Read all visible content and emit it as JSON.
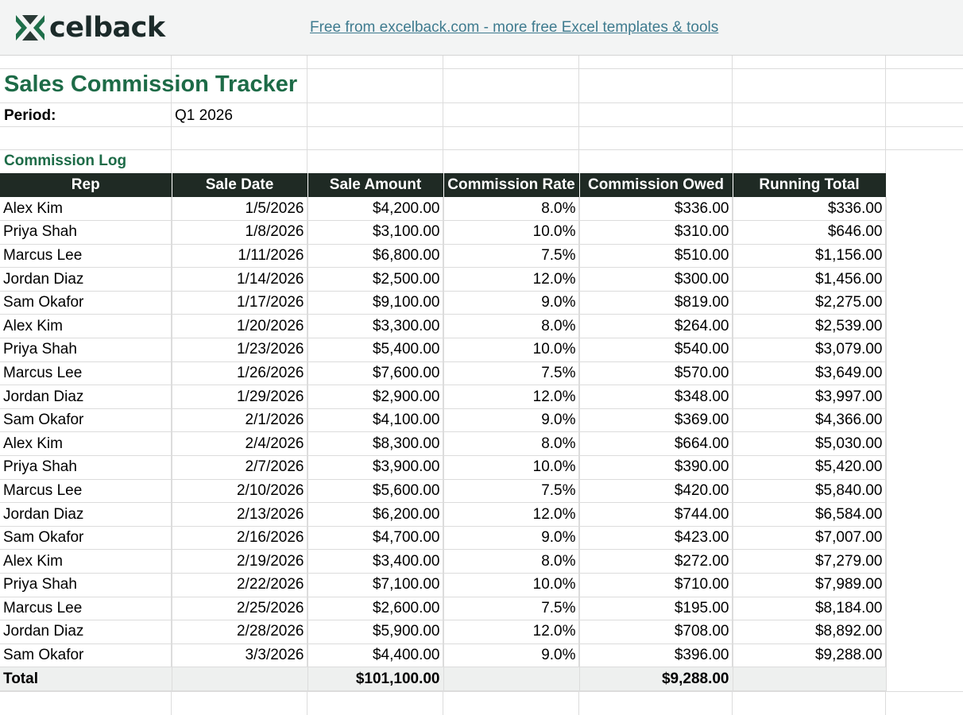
{
  "banner": {
    "logo_text": "celback",
    "link_text": "Free from excelback.com - more free Excel templates & tools"
  },
  "sheet": {
    "title": "Sales Commission Tracker",
    "period_label": "Period:",
    "period_value": "Q1 2026",
    "section_label": "Commission Log",
    "headers": [
      "Rep",
      "Sale Date",
      "Sale Amount",
      "Commission Rate",
      "Commission Owed",
      "Running Total"
    ],
    "rows": [
      [
        "Alex Kim",
        "1/5/2026",
        "$4,200.00",
        "8.0%",
        "$336.00",
        "$336.00"
      ],
      [
        "Priya Shah",
        "1/8/2026",
        "$3,100.00",
        "10.0%",
        "$310.00",
        "$646.00"
      ],
      [
        "Marcus Lee",
        "1/11/2026",
        "$6,800.00",
        "7.5%",
        "$510.00",
        "$1,156.00"
      ],
      [
        "Jordan Diaz",
        "1/14/2026",
        "$2,500.00",
        "12.0%",
        "$300.00",
        "$1,456.00"
      ],
      [
        "Sam Okafor",
        "1/17/2026",
        "$9,100.00",
        "9.0%",
        "$819.00",
        "$2,275.00"
      ],
      [
        "Alex Kim",
        "1/20/2026",
        "$3,300.00",
        "8.0%",
        "$264.00",
        "$2,539.00"
      ],
      [
        "Priya Shah",
        "1/23/2026",
        "$5,400.00",
        "10.0%",
        "$540.00",
        "$3,079.00"
      ],
      [
        "Marcus Lee",
        "1/26/2026",
        "$7,600.00",
        "7.5%",
        "$570.00",
        "$3,649.00"
      ],
      [
        "Jordan Diaz",
        "1/29/2026",
        "$2,900.00",
        "12.0%",
        "$348.00",
        "$3,997.00"
      ],
      [
        "Sam Okafor",
        "2/1/2026",
        "$4,100.00",
        "9.0%",
        "$369.00",
        "$4,366.00"
      ],
      [
        "Alex Kim",
        "2/4/2026",
        "$8,300.00",
        "8.0%",
        "$664.00",
        "$5,030.00"
      ],
      [
        "Priya Shah",
        "2/7/2026",
        "$3,900.00",
        "10.0%",
        "$390.00",
        "$5,420.00"
      ],
      [
        "Marcus Lee",
        "2/10/2026",
        "$5,600.00",
        "7.5%",
        "$420.00",
        "$5,840.00"
      ],
      [
        "Jordan Diaz",
        "2/13/2026",
        "$6,200.00",
        "12.0%",
        "$744.00",
        "$6,584.00"
      ],
      [
        "Sam Okafor",
        "2/16/2026",
        "$4,700.00",
        "9.0%",
        "$423.00",
        "$7,007.00"
      ],
      [
        "Alex Kim",
        "2/19/2026",
        "$3,400.00",
        "8.0%",
        "$272.00",
        "$7,279.00"
      ],
      [
        "Priya Shah",
        "2/22/2026",
        "$7,100.00",
        "10.0%",
        "$710.00",
        "$7,989.00"
      ],
      [
        "Marcus Lee",
        "2/25/2026",
        "$2,600.00",
        "7.5%",
        "$195.00",
        "$8,184.00"
      ],
      [
        "Jordan Diaz",
        "2/28/2026",
        "$5,900.00",
        "12.0%",
        "$708.00",
        "$8,892.00"
      ],
      [
        "Sam Okafor",
        "3/3/2026",
        "$4,400.00",
        "9.0%",
        "$396.00",
        "$9,288.00"
      ]
    ],
    "total": [
      "Total",
      "",
      "$101,100.00",
      "",
      "$9,288.00",
      ""
    ]
  },
  "colors": {
    "brand_green": "#1d6b47",
    "header_bg": "#1f2a24",
    "link": "#3f7b8f"
  }
}
